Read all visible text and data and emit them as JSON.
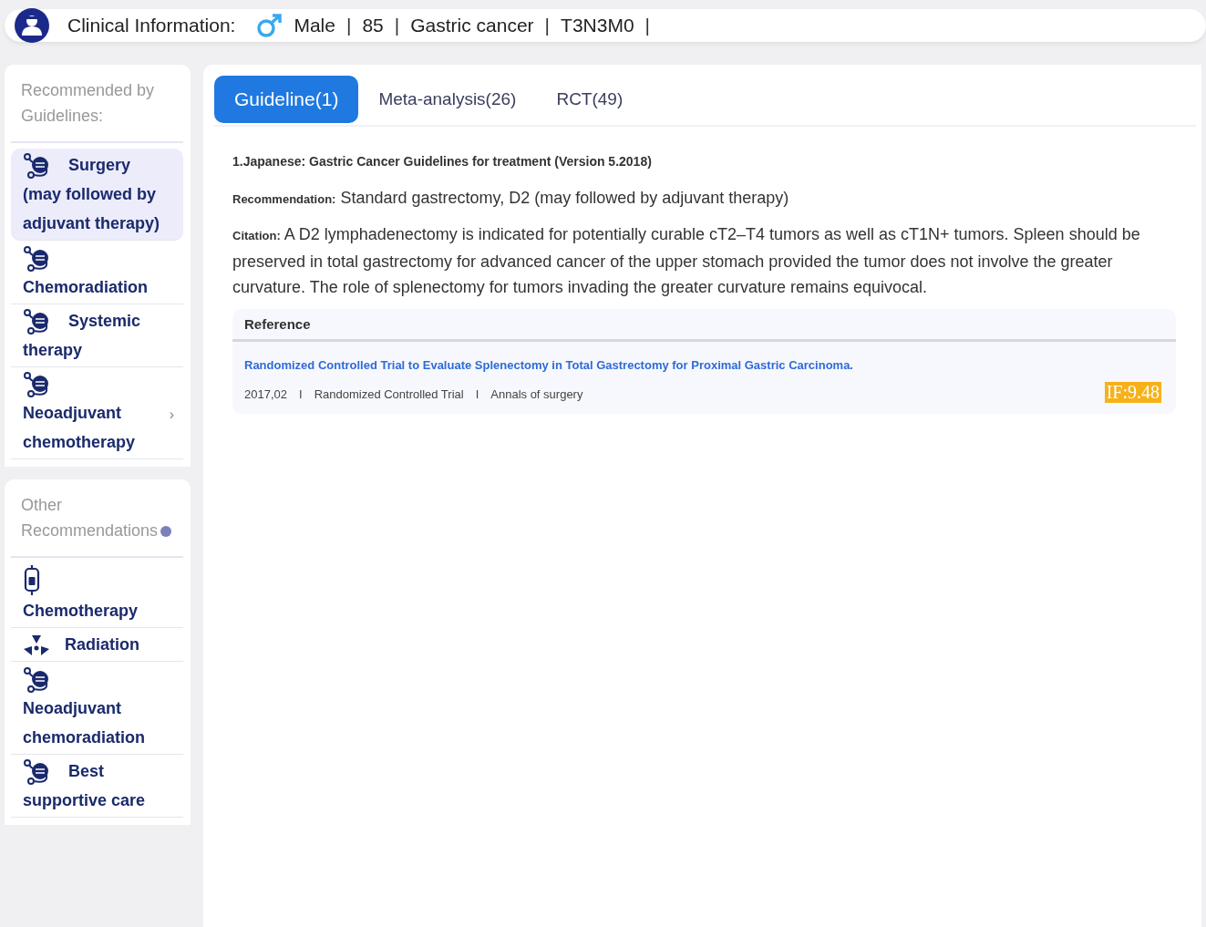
{
  "header": {
    "label": "Clinical Information:",
    "fields": [
      {
        "text": "Male",
        "separator": "|"
      },
      {
        "text": "85",
        "separator": "|"
      },
      {
        "text": "Gastric cancer",
        "separator": "|"
      },
      {
        "text": "T3N3M0",
        "separator": "|"
      }
    ]
  },
  "sidebar": {
    "sections": [
      {
        "title": "Recommended by Guidelines:",
        "info": false,
        "items": [
          {
            "kind": "device",
            "label": "Surgery (may followed by adjuvant therapy)",
            "selected": true
          },
          {
            "kind": "device",
            "label": "Chemoradiation",
            "selected": false
          },
          {
            "kind": "device",
            "label": "Systemic therapy",
            "selected": false
          },
          {
            "kind": "device",
            "label": "Neoadjuvant chemotherapy",
            "selected": false,
            "chevron": "›"
          }
        ]
      },
      {
        "title": "Other Recommendations",
        "info": true,
        "items": [
          {
            "kind": "iv-bag",
            "label": "Chemotherapy",
            "selected": false
          },
          {
            "kind": "radiation",
            "label": "Radiation",
            "selected": false
          },
          {
            "kind": "device",
            "label": "Neoadjuvant chemoradiation",
            "selected": false
          },
          {
            "kind": "device",
            "label": "Best supportive care",
            "selected": false
          }
        ]
      }
    ]
  },
  "tabs": [
    {
      "label": "Guideline(1)",
      "selected": true
    },
    {
      "label": "Meta-analysis(26)",
      "selected": false
    },
    {
      "label": "RCT(49)",
      "selected": false
    }
  ],
  "guideline": {
    "title": "1.Japanese: Gastric Cancer Guidelines for treatment (Version 5.2018)",
    "recommendation": {
      "label": "Recommendation:",
      "text": "Standard gastrectomy, D2 (may followed by adjuvant therapy)"
    },
    "citation": {
      "label": "Citation:",
      "text": "A D2 lymphadenectomy is indicated for potentially curable cT2–T4 tumors as well as cT1N+ tumors. Spleen should be preserved in total gastrectomy for advanced cancer of the upper stomach provided the tumor does not involve the greater curvature. The role of splenectomy for tumors invading the greater curvature remains equivocal."
    },
    "reference": {
      "heading": "Reference",
      "title": "Randomized Controlled Trial to Evaluate Splenectomy in Total Gastrectomy for Proximal Gastric Carcinoma.",
      "meta": [
        {
          "text": "2017,02"
        },
        {
          "separator": "I",
          "text": "Randomized Controlled Trial"
        },
        {
          "separator": "I",
          "text": "Annals of surgery"
        }
      ],
      "impact": "IF:9.48"
    }
  }
}
